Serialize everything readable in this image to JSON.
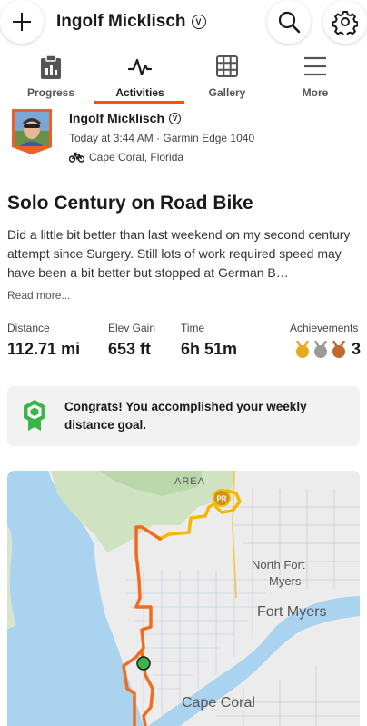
{
  "header": {
    "title": "Ingolf Micklisch",
    "verified_mark": "V",
    "add_icon": "plus-icon",
    "search_icon": "search-icon",
    "settings_icon": "gear-icon"
  },
  "tabs": [
    {
      "label": "Progress",
      "icon": "clipboard-chart-icon"
    },
    {
      "label": "Activities",
      "icon": "activity-pulse-icon"
    },
    {
      "label": "Gallery",
      "icon": "grid-icon"
    },
    {
      "label": "More",
      "icon": "menu-icon"
    }
  ],
  "active_tab": "Activities",
  "activity": {
    "athlete": "Ingolf Micklisch",
    "verified_mark": "V",
    "meta": "Today at 3:44 AM · Garmin Edge 1040",
    "location": "Cape Coral, Florida",
    "sport_icon": "bike-icon",
    "title": "Solo Century on Road Bike",
    "description": "Did a little bit better than last weekend on my second century attempt since Surgery. Still lots of work required speed may have been a bit better but stopped at German B…",
    "read_more": "Read more..."
  },
  "stats": {
    "distance": {
      "label": "Distance",
      "value": "112.71 mi"
    },
    "elev_gain": {
      "label": "Elev Gain",
      "value": "653 ft"
    },
    "time": {
      "label": "Time",
      "value": "6h 51m"
    },
    "achievements": {
      "label": "Achievements",
      "count": "3"
    }
  },
  "goal": {
    "icon": "goal-badge-icon",
    "text": "Congrats! You accomplished your weekly distance goal."
  },
  "map": {
    "labels": {
      "area": "AREA",
      "north_fort_myers": "North Fort Myers",
      "fort_myers": "Fort Myers",
      "cape_coral": "Cape Coral",
      "pr_badge": "PR"
    }
  },
  "colors": {
    "accent": "#fc5200",
    "route": "#f26b1d",
    "route_yellow": "#f5b800",
    "goal_green": "#3bb54a",
    "gold": "#e8a820",
    "silver": "#9a9a9a",
    "bronze": "#c1682c"
  }
}
